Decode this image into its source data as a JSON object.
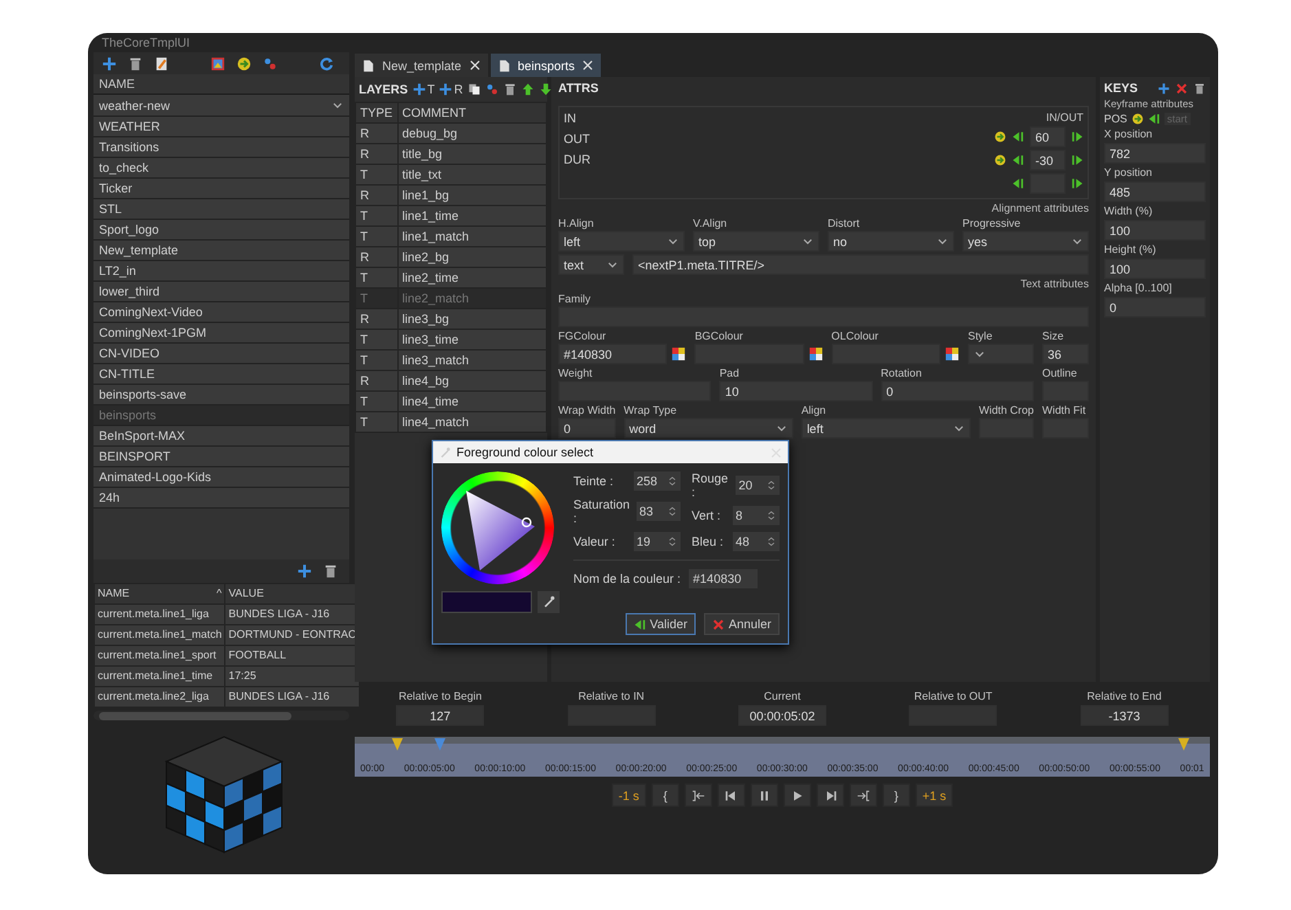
{
  "window": {
    "title": "TheCoreTmplUI"
  },
  "templates": {
    "header": "NAME",
    "combo": "weather-new",
    "items": [
      {
        "label": "WEATHER",
        "selected": false
      },
      {
        "label": "Transitions",
        "selected": false
      },
      {
        "label": "to_check",
        "selected": false
      },
      {
        "label": "Ticker",
        "selected": false
      },
      {
        "label": "STL",
        "selected": false
      },
      {
        "label": "Sport_logo",
        "selected": false
      },
      {
        "label": "New_template",
        "selected": false
      },
      {
        "label": "LT2_in",
        "selected": false
      },
      {
        "label": "lower_third",
        "selected": false
      },
      {
        "label": "ComingNext-Video",
        "selected": false
      },
      {
        "label": "ComingNext-1PGM",
        "selected": false
      },
      {
        "label": "CN-VIDEO",
        "selected": false
      },
      {
        "label": "CN-TITLE",
        "selected": false
      },
      {
        "label": "beinsports-save",
        "selected": false
      },
      {
        "label": "beinsports",
        "selected": true
      },
      {
        "label": "BeInSport-MAX",
        "selected": false
      },
      {
        "label": "BEINSPORT",
        "selected": false
      },
      {
        "label": "Animated-Logo-Kids",
        "selected": false
      },
      {
        "label": "24h",
        "selected": false
      }
    ]
  },
  "variables": {
    "columns": [
      "NAME",
      "VALUE"
    ],
    "sort_mark": "^",
    "rows": [
      [
        "current.meta.line1_liga",
        "BUNDES LIGA - J16"
      ],
      [
        "current.meta.line1_match",
        "DORTMUND - EONTRAC"
      ],
      [
        "current.meta.line1_sport",
        "FOOTBALL"
      ],
      [
        "current.meta.line1_time",
        "17:25"
      ],
      [
        "current.meta.line2_liga",
        "BUNDES LIGA - J16"
      ]
    ]
  },
  "tabs": [
    {
      "label": "New_template",
      "selected": false
    },
    {
      "label": "beinsports",
      "selected": true
    }
  ],
  "layers": {
    "title": "LAYERS",
    "add_buttons": [
      "T",
      "R"
    ],
    "columns": [
      "TYPE",
      "COMMENT"
    ],
    "rows": [
      {
        "type": "R",
        "comment": "debug_bg",
        "selected": false
      },
      {
        "type": "R",
        "comment": "title_bg",
        "selected": false
      },
      {
        "type": "T",
        "comment": "title_txt",
        "selected": false
      },
      {
        "type": "R",
        "comment": "line1_bg",
        "selected": false
      },
      {
        "type": "T",
        "comment": "line1_time",
        "selected": false
      },
      {
        "type": "T",
        "comment": "line1_match",
        "selected": false
      },
      {
        "type": "R",
        "comment": "line2_bg",
        "selected": false
      },
      {
        "type": "T",
        "comment": "line2_time",
        "selected": false
      },
      {
        "type": "T",
        "comment": "line2_match",
        "selected": true
      },
      {
        "type": "R",
        "comment": "line3_bg",
        "selected": false
      },
      {
        "type": "T",
        "comment": "line3_time",
        "selected": false
      },
      {
        "type": "T",
        "comment": "line3_match",
        "selected": false
      },
      {
        "type": "R",
        "comment": "line4_bg",
        "selected": false
      },
      {
        "type": "T",
        "comment": "line4_time",
        "selected": false
      },
      {
        "type": "T",
        "comment": "line4_match",
        "selected": false
      }
    ]
  },
  "attrs": {
    "title": "ATTRS",
    "timing": [
      "IN",
      "OUT",
      "DUR"
    ],
    "in_out": {
      "label": "IN/OUT",
      "values": [
        "60",
        "-30"
      ]
    },
    "rows": [
      {
        "note": "Alignment attributes",
        "fields": [
          {
            "kind": "select",
            "label": "H.Align",
            "value": "left"
          },
          {
            "kind": "select",
            "label": "V.Align",
            "value": "top"
          },
          {
            "kind": "select",
            "label": "Distort",
            "value": "no"
          },
          {
            "kind": "select",
            "label": "Progressive",
            "value": "yes"
          }
        ]
      },
      {
        "fields": [
          {
            "kind": "narrow-select",
            "value": "text"
          },
          {
            "kind": "input",
            "value": "<nextP1.meta.TITRE/>"
          }
        ]
      },
      {
        "note": "Text attributes",
        "fields": [
          {
            "kind": "input",
            "label": "Family"
          }
        ]
      },
      {
        "fields": [
          {
            "kind": "colour",
            "label": "FGColour",
            "value": "#140830"
          },
          {
            "kind": "colour",
            "label": "BGColour"
          },
          {
            "kind": "colour",
            "label": "OLColour"
          },
          {
            "kind": "narrow-select",
            "label": "Style"
          },
          {
            "kind": "narrow",
            "label": "Size",
            "value": "36"
          }
        ]
      },
      {
        "fields": [
          {
            "kind": "input",
            "label": "Weight"
          },
          {
            "kind": "input",
            "label": "Pad",
            "value": "10"
          },
          {
            "kind": "input",
            "label": "Rotation",
            "value": "0"
          },
          {
            "kind": "narrow",
            "label": "Outline"
          }
        ]
      },
      {
        "fields": [
          {
            "kind": "narrow",
            "label": "Wrap Width",
            "value": "0"
          },
          {
            "kind": "select",
            "label": "Wrap Type",
            "value": "word"
          },
          {
            "kind": "select",
            "label": "Align",
            "value": "left"
          },
          {
            "kind": "narrow",
            "label": "Width Crop"
          },
          {
            "kind": "narrow",
            "label": "Width Fit"
          }
        ]
      }
    ]
  },
  "keys": {
    "title": "KEYS",
    "subtitle": "Keyframe attributes",
    "pos_label": "POS",
    "start_button": "start",
    "fields": [
      {
        "label": "X position",
        "value": "782"
      },
      {
        "label": "Y position",
        "value": "485"
      },
      {
        "label": "Width (%)",
        "value": "100"
      },
      {
        "label": "Height (%)",
        "value": "100"
      },
      {
        "label": "Alpha [0..100]",
        "value": "0"
      }
    ]
  },
  "dialog": {
    "title": "Foreground colour select",
    "left_fields": [
      {
        "label": "Teinte :",
        "value": "258"
      },
      {
        "label": "Saturation :",
        "value": "83"
      },
      {
        "label": "Valeur :",
        "value": "19"
      }
    ],
    "right_fields": [
      {
        "label": "Rouge :",
        "value": "20"
      },
      {
        "label": "Vert :",
        "value": "8"
      },
      {
        "label": "Bleu :",
        "value": "48"
      }
    ],
    "name_label": "Nom de la couleur :",
    "name_value": "#140830",
    "buttons": [
      "Valider",
      "Annuler"
    ]
  },
  "readouts": [
    {
      "label": "Relative to Begin",
      "value": "127"
    },
    {
      "label": "Relative to IN"
    },
    {
      "label": "Current",
      "value": "00:00:05:02"
    },
    {
      "label": "Relative to OUT"
    },
    {
      "label": "Relative to End",
      "value": "-1373"
    }
  ],
  "timeline": {
    "ticks": [
      "00:00",
      "00:00:05:00",
      "00:00:10:00",
      "00:00:15:00",
      "00:00:20:00",
      "00:00:25:00",
      "00:00:30:00",
      "00:00:35:00",
      "00:00:40:00",
      "00:00:45:00",
      "00:00:50:00",
      "00:00:55:00",
      "00:01"
    ],
    "markers": [
      {
        "kind": "in",
        "level": 0.05
      },
      {
        "kind": "current",
        "level": 0.1
      },
      {
        "kind": "out",
        "level": 0.97
      }
    ]
  },
  "transport": [
    {
      "kind": "text",
      "label": "-1 s"
    },
    {
      "kind": "text",
      "label": "{"
    },
    {
      "kind": "to-in"
    },
    {
      "kind": "step-back"
    },
    {
      "kind": "pause"
    },
    {
      "kind": "play"
    },
    {
      "kind": "step-forward"
    },
    {
      "kind": "to-out"
    },
    {
      "kind": "text",
      "label": "}"
    },
    {
      "kind": "text",
      "label": "+1 s"
    }
  ]
}
